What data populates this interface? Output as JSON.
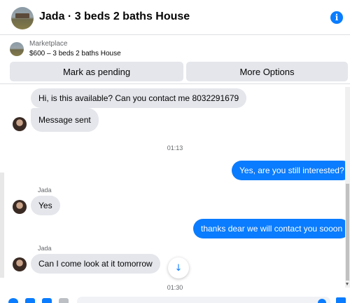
{
  "header": {
    "title": "Jada · 3 beds 2 baths House",
    "info_icon": "i"
  },
  "marketplace": {
    "label": "Marketplace",
    "listing": "$600 – 3 beds 2 baths House",
    "mark_pending_label": "Mark as pending",
    "more_options_label": "More Options"
  },
  "messages": [
    {
      "from": "Jada",
      "text": "Hi, is this available? Can you contact me 8032291679"
    },
    {
      "from": "Jada",
      "text": "Message sent"
    },
    {
      "type": "timestamp",
      "text": "01:13"
    },
    {
      "from": "me",
      "text": "Yes, are you still interested?"
    },
    {
      "type": "sender",
      "text": "Jada"
    },
    {
      "from": "Jada",
      "text": "Yes"
    },
    {
      "from": "me",
      "text": "thanks dear we will contact you sooon"
    },
    {
      "type": "sender",
      "text": "Jada"
    },
    {
      "from": "Jada",
      "text": "Can I come look at it tomorrow"
    },
    {
      "type": "timestamp",
      "text": "01:30"
    }
  ],
  "scroll_down_icon": "↓",
  "colors": {
    "accent": "#0a7cff",
    "incoming_bubble": "#e4e6eb",
    "button_bg": "#e4e6eb",
    "secondary_text": "#65676b"
  }
}
